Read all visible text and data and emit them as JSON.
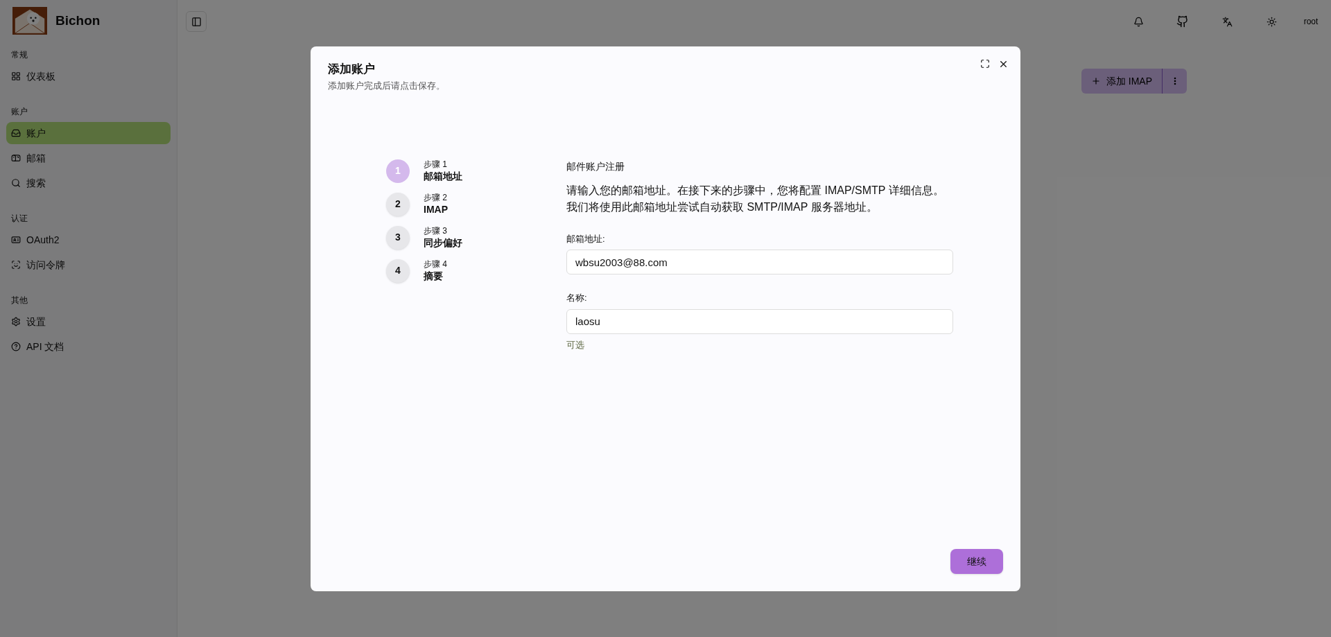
{
  "sidebar": {
    "brand": "Bichon",
    "sections": [
      {
        "heading": "常规",
        "items": [
          {
            "label": "仪表板",
            "selected": false
          }
        ]
      },
      {
        "heading": "账户",
        "items": [
          {
            "label": "账户",
            "selected": true
          },
          {
            "label": "邮箱",
            "selected": false
          },
          {
            "label": "搜索",
            "selected": false
          }
        ]
      },
      {
        "heading": "认证",
        "items": [
          {
            "label": "OAuth2",
            "selected": false
          },
          {
            "label": "访问令牌",
            "selected": false
          }
        ]
      },
      {
        "heading": "其他",
        "items": [
          {
            "label": "设置",
            "selected": false
          },
          {
            "label": "API 文档",
            "selected": false
          }
        ]
      }
    ]
  },
  "header": {
    "user": "root"
  },
  "page": {
    "add_button": "添加 IMAP"
  },
  "dialog": {
    "title": "添加账户",
    "subtitle": "添加账户完成后请点击保存。",
    "steps": [
      {
        "number": "1",
        "caption": "步骤 1",
        "title": "邮箱地址",
        "selected": true
      },
      {
        "number": "2",
        "caption": "步骤 2",
        "title": "IMAP",
        "selected": false
      },
      {
        "number": "3",
        "caption": "步骤 3",
        "title": "同步偏好",
        "selected": false
      },
      {
        "number": "4",
        "caption": "步骤 4",
        "title": "摘要",
        "selected": false
      }
    ],
    "heading": "邮件账户注册",
    "intro": [
      "请输入您的邮箱地址。在接下来的步骤中，您将配置 IMAP/SMTP 详细信息。",
      "我们将使用此邮箱地址尝试自动获取 SMTP/IMAP 服务器地址。"
    ],
    "fields": [
      {
        "label": "邮箱地址:",
        "value": "wbsu2003@88.com"
      },
      {
        "label": "名称:",
        "value": "laosu",
        "hint": "可选"
      }
    ],
    "continue_button": "继续"
  }
}
